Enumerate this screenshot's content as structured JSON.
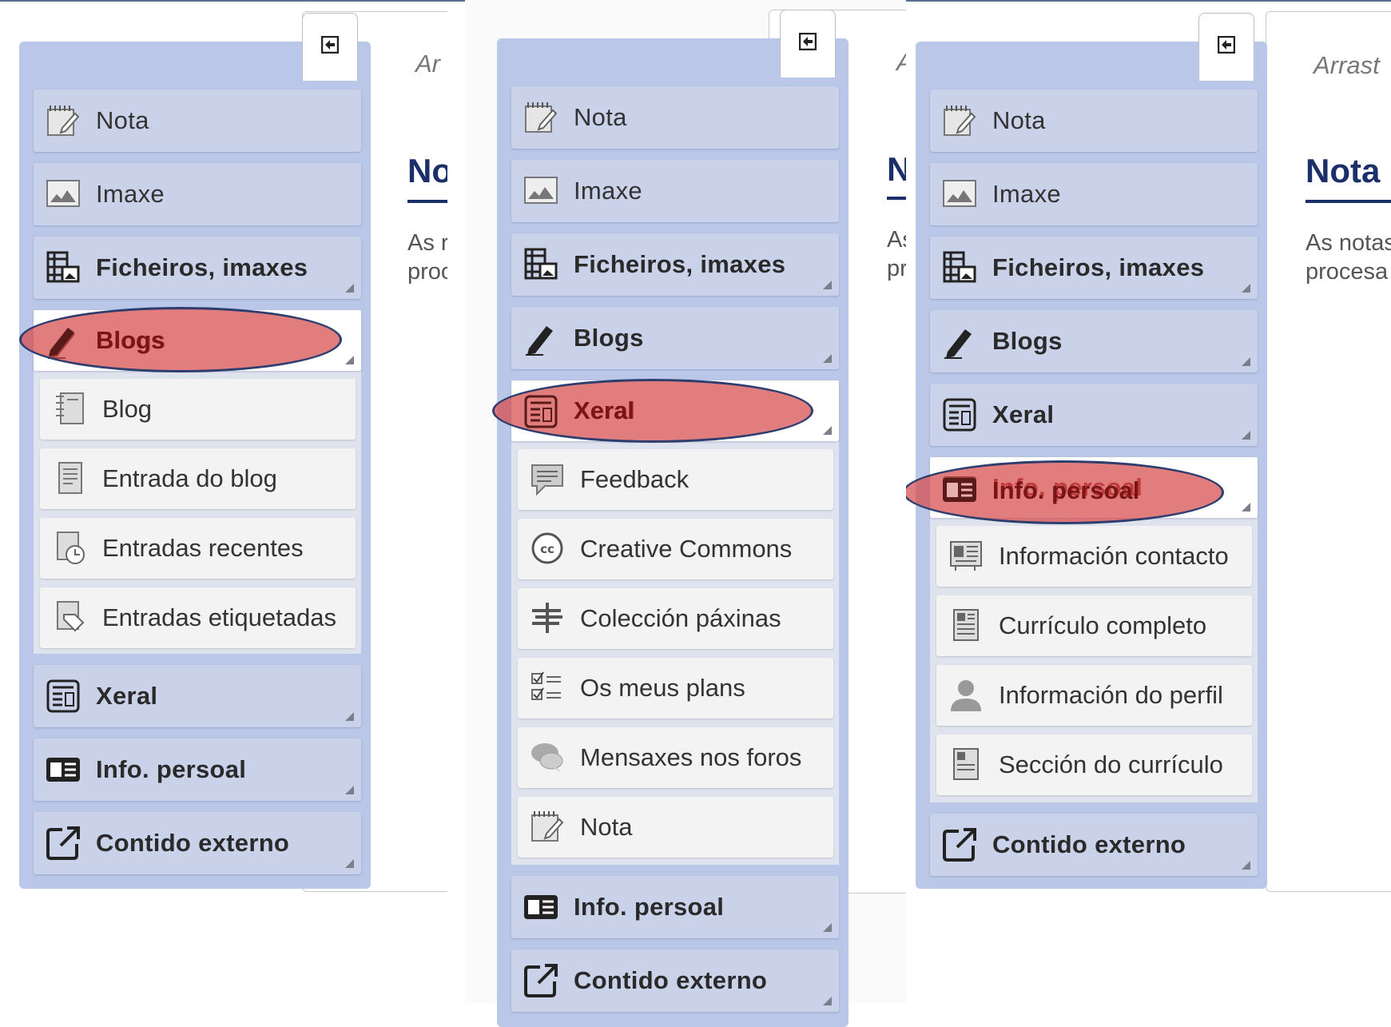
{
  "panels": [
    {
      "drag_hint": "Ar",
      "page_title": "No",
      "page_text_1": "As r",
      "page_text_2": "proc",
      "categories_top": [
        {
          "label": "Nota",
          "icon": "note-icon"
        },
        {
          "label": "Imaxe",
          "icon": "image-icon"
        },
        {
          "label": "Ficheiros, imaxes",
          "icon": "files-images-icon"
        }
      ],
      "active": {
        "label": "Blogs",
        "icon": "pencil-icon"
      },
      "subitems": [
        {
          "label": "Blog",
          "icon": "blog-icon"
        },
        {
          "label": "Entrada do blog",
          "icon": "blog-entry-icon"
        },
        {
          "label": "Entradas recentes",
          "icon": "recent-entries-icon"
        },
        {
          "label": "Entradas etiquetadas",
          "icon": "tagged-entries-icon"
        }
      ],
      "categories_bottom": [
        {
          "label": "Xeral",
          "icon": "general-icon"
        },
        {
          "label": "Info. persoal",
          "icon": "personal-info-icon"
        },
        {
          "label": "Contido externo",
          "icon": "external-content-icon"
        }
      ]
    },
    {
      "drag_hint": "A",
      "page_title": "N",
      "page_text_1": "As",
      "page_text_2": "pr",
      "categories_top": [
        {
          "label": "Nota",
          "icon": "note-icon"
        },
        {
          "label": "Imaxe",
          "icon": "image-icon"
        },
        {
          "label": "Ficheiros, imaxes",
          "icon": "files-images-icon"
        },
        {
          "label": "Blogs",
          "icon": "pencil-icon"
        }
      ],
      "active": {
        "label": "Xeral",
        "icon": "general-icon"
      },
      "subitems": [
        {
          "label": "Feedback",
          "icon": "feedback-icon"
        },
        {
          "label": "Creative Commons",
          "icon": "creative-commons-icon"
        },
        {
          "label": "Colección páxinas",
          "icon": "page-collection-icon"
        },
        {
          "label": "Os meus plans",
          "icon": "plans-icon"
        },
        {
          "label": "Mensaxes nos foros",
          "icon": "forum-messages-icon"
        },
        {
          "label": "Nota",
          "icon": "note-icon"
        }
      ],
      "categories_bottom": [
        {
          "label": "Info. persoal",
          "icon": "personal-info-icon"
        },
        {
          "label": "Contido externo",
          "icon": "external-content-icon"
        }
      ]
    },
    {
      "drag_hint": "Arrast",
      "page_title": "Nota",
      "page_text_1": "As notas",
      "page_text_2": "procesa",
      "categories_top": [
        {
          "label": "Nota",
          "icon": "note-icon"
        },
        {
          "label": "Imaxe",
          "icon": "image-icon"
        },
        {
          "label": "Ficheiros, imaxes",
          "icon": "files-images-icon"
        },
        {
          "label": "Blogs",
          "icon": "pencil-icon"
        },
        {
          "label": "Xeral",
          "icon": "general-icon"
        }
      ],
      "active": {
        "label": "Info. persoal",
        "icon": "personal-info-icon"
      },
      "subitems": [
        {
          "label": "Información contacto",
          "icon": "contact-info-icon"
        },
        {
          "label": "Currículo completo",
          "icon": "full-resume-icon"
        },
        {
          "label": "Información do perfil",
          "icon": "profile-info-icon"
        },
        {
          "label": "Sección do currículo",
          "icon": "resume-section-icon"
        }
      ],
      "categories_bottom": [
        {
          "label": "Contido externo",
          "icon": "external-content-icon"
        }
      ]
    }
  ]
}
